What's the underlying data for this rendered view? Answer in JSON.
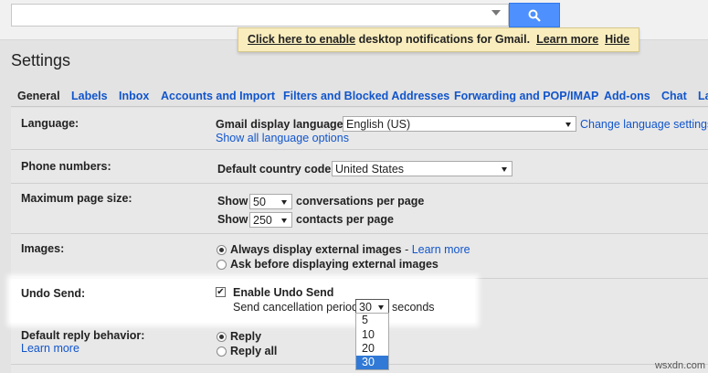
{
  "header": {
    "search_placeholder": "",
    "notification": {
      "link1": "Click here to enable",
      "text": " desktop notifications for Gmail.",
      "learn_more": "Learn more",
      "hide": "Hide"
    }
  },
  "page_title": "Settings",
  "tabs": [
    {
      "label": "General",
      "active": true
    },
    {
      "label": "Labels"
    },
    {
      "label": "Inbox"
    },
    {
      "label": "Accounts and Import"
    },
    {
      "label": "Filters and Blocked Addresses"
    },
    {
      "label": "Forwarding and POP/IMAP"
    },
    {
      "label": "Add-ons"
    },
    {
      "label": "Chat"
    },
    {
      "label": "La"
    }
  ],
  "settings": {
    "language": {
      "label": "Language:",
      "display_label": "Gmail display language:",
      "value": "English (US)",
      "change_link": "Change language settings",
      "show_all": "Show all language options"
    },
    "phone": {
      "label": "Phone numbers:",
      "country_label": "Default country code:",
      "country_value": "United States"
    },
    "page_size": {
      "label": "Maximum page size:",
      "show": "Show",
      "conversations_value": "50",
      "conversations_text": "conversations per page",
      "contacts_value": "250",
      "contacts_text": "contacts per page"
    },
    "images": {
      "label": "Images:",
      "option1": "Always display external images",
      "dash": " - ",
      "learn_more": "Learn more",
      "option2": "Ask before displaying external images"
    },
    "undo_send": {
      "label": "Undo Send:",
      "enable_label": "Enable Undo Send",
      "period_label": "Send cancellation period:",
      "period_value": "30",
      "seconds": "seconds",
      "options": [
        "5",
        "10",
        "20",
        "30"
      ],
      "selected_option": "30"
    },
    "reply": {
      "label": "Default reply behavior:",
      "learn_more": "Learn more",
      "option1": "Reply",
      "option2": "Reply all"
    }
  },
  "watermark": "wsxdn.com"
}
